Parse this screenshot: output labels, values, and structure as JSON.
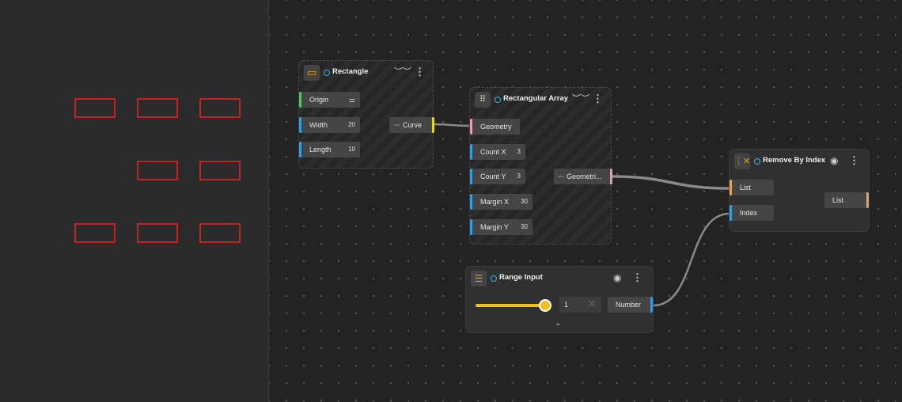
{
  "preview": {
    "rectangles": [
      {
        "row": 1,
        "col": 1
      },
      {
        "row": 1,
        "col": 2
      },
      {
        "row": 1,
        "col": 3
      },
      {
        "row": 2,
        "col": 2
      },
      {
        "row": 2,
        "col": 3
      },
      {
        "row": 3,
        "col": 1
      },
      {
        "row": 3,
        "col": 2
      },
      {
        "row": 3,
        "col": 3
      }
    ],
    "rect_color": "#c42222"
  },
  "nodes": {
    "rectangle": {
      "title": "Rectangle",
      "inputs": {
        "origin": "Origin",
        "width": "Width",
        "width_value": "20",
        "length": "Length",
        "length_value": "10"
      },
      "output": "Curve"
    },
    "rectangular_array": {
      "title": "Rectangular Array",
      "inputs": {
        "geometry": "Geometry",
        "count_x": "Count X",
        "count_x_value": "3",
        "count_y": "Count Y",
        "count_y_value": "3",
        "margin_x": "Margin X",
        "margin_x_value": "30",
        "margin_y": "Margin Y",
        "margin_y_value": "30"
      },
      "output": "Geometri..."
    },
    "remove_by_index": {
      "title": "Remove By Index",
      "inputs": {
        "list": "List",
        "index": "Index"
      },
      "output": "List"
    },
    "range_input": {
      "title": "Range Input",
      "value": "1",
      "slider_fraction": 1.0,
      "output": "Number"
    }
  },
  "icons": {
    "rectangle": "rectangle-icon",
    "array": "grid-icon",
    "remove": "remove-list-icon",
    "range": "sliders-icon",
    "hidden": "eye-closed-icon",
    "visible": "eye-icon",
    "menu": "more-vertical-icon"
  },
  "colors": {
    "accent_blue": "#3b9bd8",
    "status_cyan": "#3ab5e6",
    "slider_yellow": "#f0c020",
    "curve_port": "#e8d22e",
    "geometry_port": "#e89ab5",
    "list_port": "#e0a560",
    "origin_port": "#5cc06a"
  }
}
